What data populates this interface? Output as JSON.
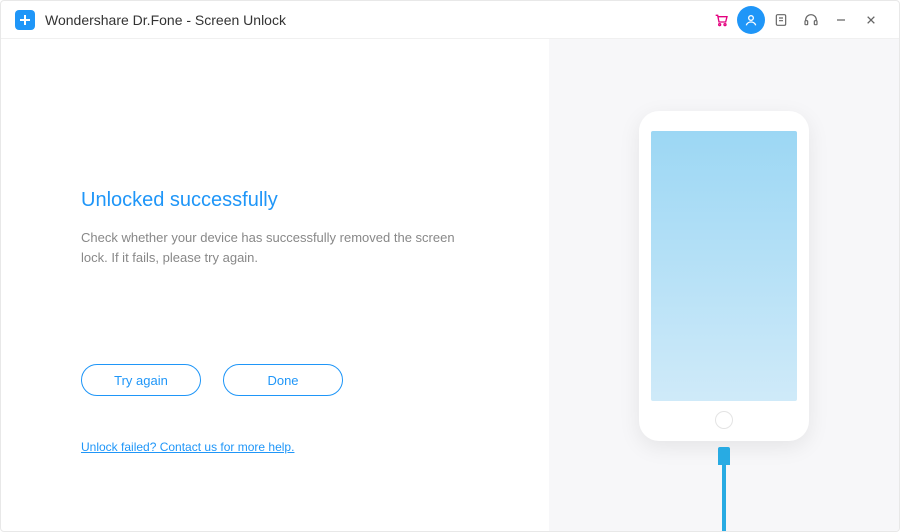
{
  "app": {
    "title": "Wondershare Dr.Fone - Screen Unlock"
  },
  "main": {
    "heading": "Unlocked successfully",
    "description": "Check whether your device has successfully removed the screen lock. If it fails, please try again.",
    "try_again_label": "Try again",
    "done_label": "Done",
    "help_link": "Unlock failed? Contact us for more help."
  },
  "titlebar_icons": {
    "cart": "cart-icon",
    "user": "user-icon",
    "feedback": "feedback-icon",
    "support": "headset-icon",
    "minimize": "minimize-icon",
    "close": "close-icon"
  }
}
